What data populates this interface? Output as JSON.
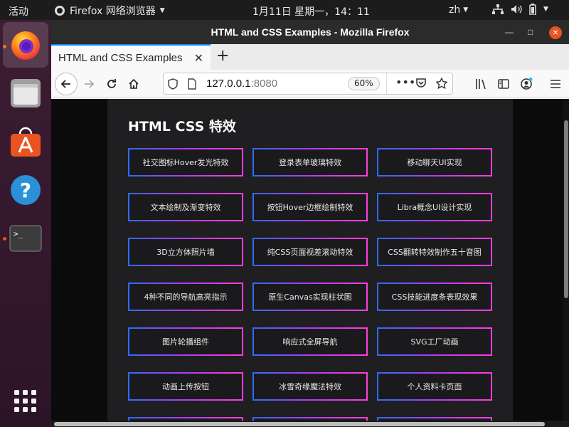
{
  "topbar": {
    "activities": "活动",
    "app_menu": "Firefox 网络浏览器",
    "clock": "1月11日 星期一，14：11",
    "lang": "zh"
  },
  "dock": {
    "items": [
      "firefox",
      "files",
      "ubuntu-software",
      "help",
      "terminal",
      "show-applications"
    ]
  },
  "window": {
    "title": "HTML and CSS Examples - Mozilla Firefox",
    "tab_title": "HTML and CSS Examples",
    "url_host": "127.0.0.1",
    "url_port": ":8080",
    "zoom": "60%"
  },
  "page": {
    "heading": "HTML CSS 特效",
    "links": [
      "社交图标Hover发光特效",
      "登录表单玻璃特效",
      "移动聊天UI实现",
      "文本绘制及渐变特效",
      "按钮Hover边框绘制特效",
      "Libra概念UI设计实现",
      "3D立方体照片墙",
      "纯CSS页面视差滚动特效",
      "CSS翻转特效制作五十音图",
      "4种不同的导航高亮指示",
      "原生Canvas实现柱状图",
      "CSS技能进度条表现效果",
      "图片轮播组件",
      "响应式全屏导航",
      "SVG工厂动画",
      "动画上传按钮",
      "冰雪奇缘魔法特效",
      "个人资料卡页面",
      "",
      "",
      ""
    ]
  },
  "colors": {
    "accent": "#e95420",
    "border_from": "#2f6bff",
    "border_to": "#ff3dde"
  }
}
